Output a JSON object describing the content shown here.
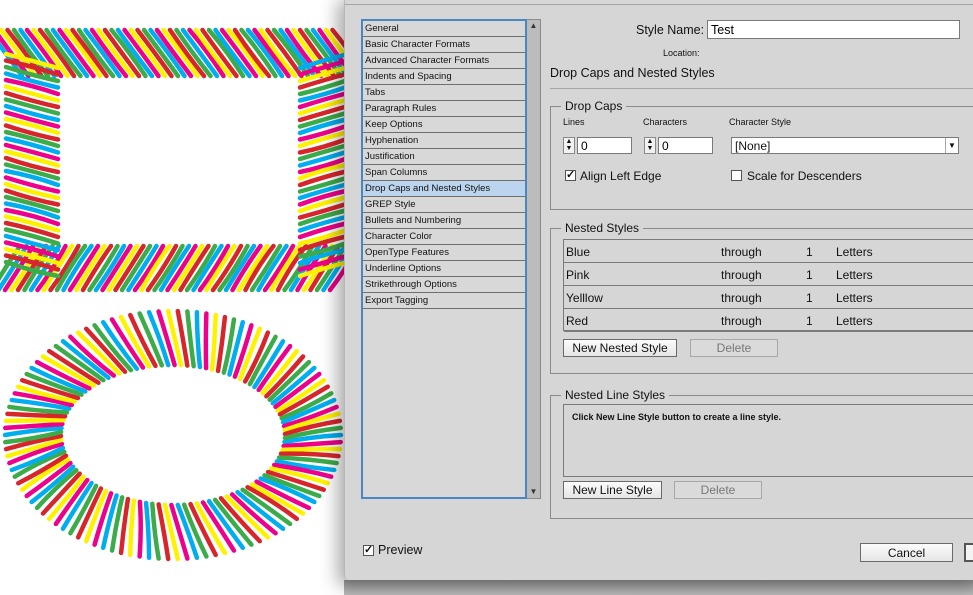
{
  "artwork": {
    "description": "Decorative rainbow stroke borders (rectangle and ellipse) on the canvas behind the dialog",
    "colors": [
      "#00aeef",
      "#ec008c",
      "#fff200",
      "#d7262b",
      "#3cab4a"
    ]
  },
  "dialog": {
    "categories": [
      {
        "label": "General"
      },
      {
        "label": "Basic Character Formats"
      },
      {
        "label": "Advanced Character Formats"
      },
      {
        "label": "Indents and Spacing"
      },
      {
        "label": "Tabs"
      },
      {
        "label": "Paragraph Rules"
      },
      {
        "label": "Keep Options"
      },
      {
        "label": "Hyphenation"
      },
      {
        "label": "Justification"
      },
      {
        "label": "Span Columns"
      },
      {
        "label": "Drop Caps and Nested Styles",
        "selected": true
      },
      {
        "label": "GREP Style"
      },
      {
        "label": "Bullets and Numbering"
      },
      {
        "label": "Character Color"
      },
      {
        "label": "OpenType Features"
      },
      {
        "label": "Underline Options"
      },
      {
        "label": "Strikethrough Options"
      },
      {
        "label": "Export Tagging"
      }
    ],
    "style_name_label": "Style Name:",
    "style_name_value": "Test",
    "location_label": "Location:",
    "section_title": "Drop Caps and Nested Styles",
    "drop_caps": {
      "legend": "Drop Caps",
      "lines_label": "Lines",
      "lines_value": "0",
      "characters_label": "Characters",
      "characters_value": "0",
      "character_style_label": "Character Style",
      "character_style_value": "[None]",
      "align_left_edge_label": "Align Left Edge",
      "align_left_edge_checked": true,
      "scale_descenders_label": "Scale for Descenders",
      "scale_descenders_checked": false
    },
    "nested_styles": {
      "legend": "Nested Styles",
      "rows": [
        {
          "style": "Blue",
          "mode": "through",
          "count": "1",
          "unit": "Letters"
        },
        {
          "style": "Pink",
          "mode": "through",
          "count": "1",
          "unit": "Letters"
        },
        {
          "style": "Yelllow",
          "mode": "through",
          "count": "1",
          "unit": "Letters"
        },
        {
          "style": "Red",
          "mode": "through",
          "count": "1",
          "unit": "Letters"
        }
      ],
      "new_button": "New Nested Style",
      "delete_button": "Delete"
    },
    "nested_line_styles": {
      "legend": "Nested Line Styles",
      "empty_message": "Click New Line Style button to create a line style.",
      "new_button": "New Line Style",
      "delete_button": "Delete"
    },
    "preview_label": "Preview",
    "preview_checked": true,
    "cancel_button": "Cancel",
    "check_glyph": "✓",
    "scroll_up_glyph": "▲",
    "scroll_down_glyph": "▼",
    "dropdown_glyph": "▼",
    "spinner_glyph": "▲▼"
  }
}
